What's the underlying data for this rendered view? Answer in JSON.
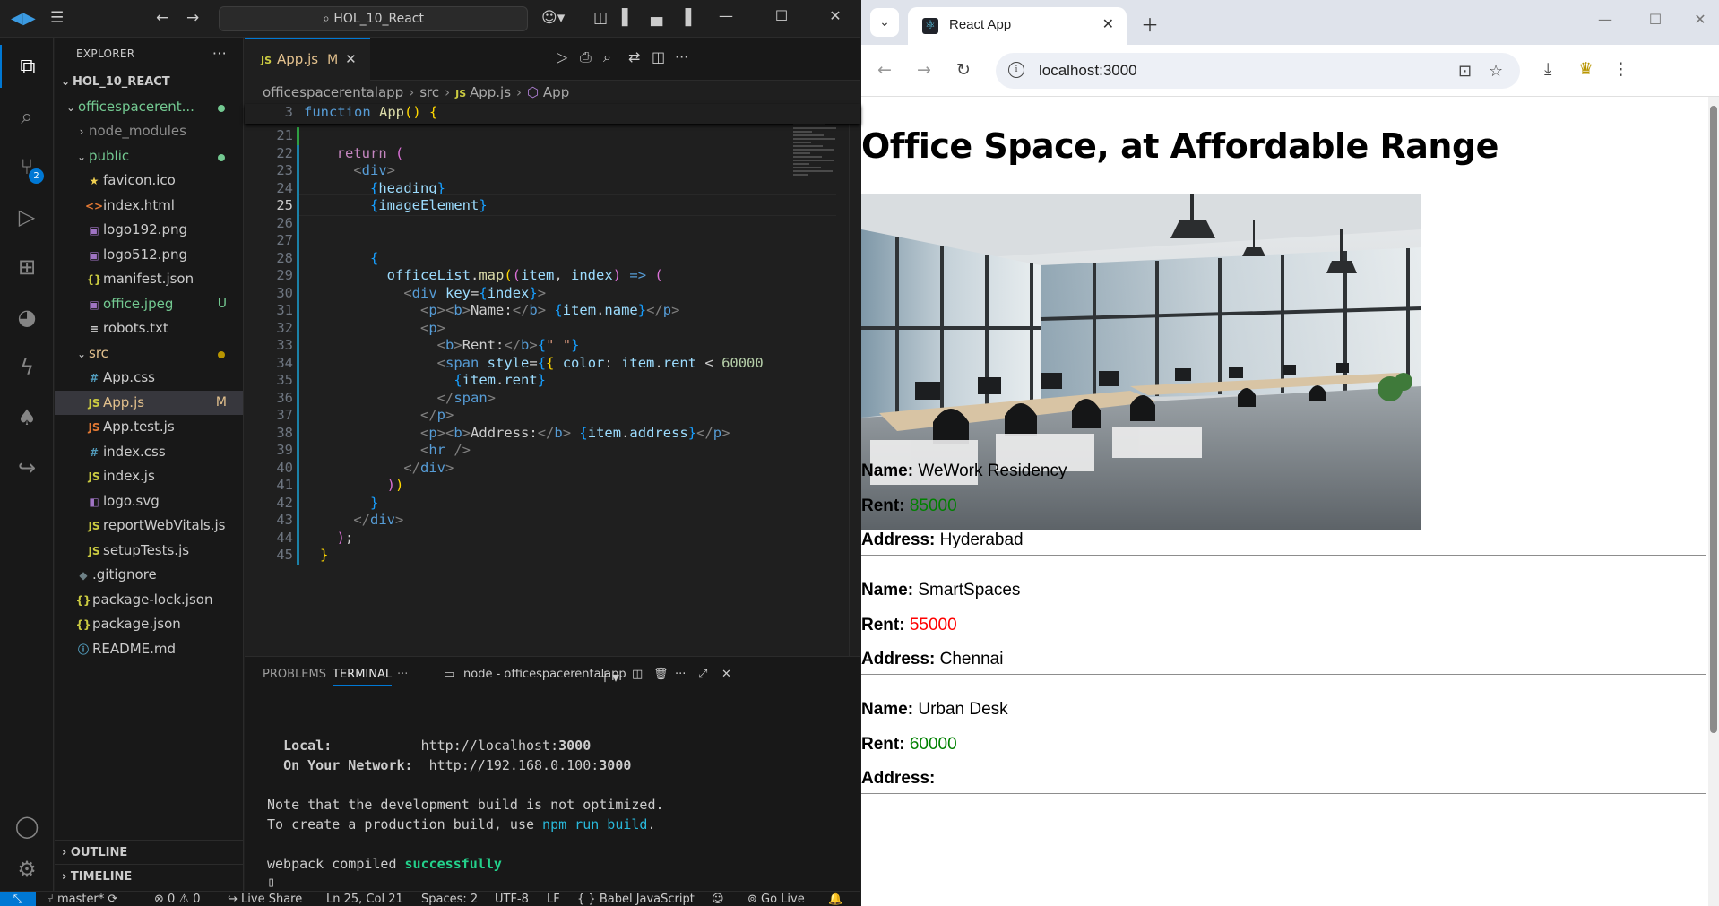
{
  "vscode": {
    "search_text": "HOL_10_React",
    "source_control_badge": "2",
    "explorer": {
      "title": "EXPLORER",
      "project": "HOL_10_REACT",
      "tree": [
        {
          "label": "officespacerent...",
          "kind": "folder-open",
          "indent": 1,
          "color": "#73c991",
          "dot": "#73c991"
        },
        {
          "label": "node_modules",
          "kind": "folder",
          "indent": 2,
          "color": "#8c8c8c"
        },
        {
          "label": "public",
          "kind": "folder-open",
          "indent": 2,
          "color": "#73c991",
          "dot": "#73c991"
        },
        {
          "label": "favicon.ico",
          "kind": "star",
          "indent": 3,
          "color": "#cccccc"
        },
        {
          "label": "index.html",
          "kind": "html",
          "indent": 3,
          "color": "#cccccc"
        },
        {
          "label": "logo192.png",
          "kind": "img",
          "indent": 3,
          "color": "#cccccc"
        },
        {
          "label": "logo512.png",
          "kind": "img",
          "indent": 3,
          "color": "#cccccc"
        },
        {
          "label": "manifest.json",
          "kind": "json",
          "indent": 3,
          "color": "#cccccc"
        },
        {
          "label": "office.jpeg",
          "kind": "img",
          "indent": 3,
          "color": "#73c991",
          "status": "U"
        },
        {
          "label": "robots.txt",
          "kind": "txt",
          "indent": 3,
          "color": "#cccccc"
        },
        {
          "label": "src",
          "kind": "folder-open",
          "indent": 2,
          "color": "#e2c08d",
          "dot": "#b89500"
        },
        {
          "label": "App.css",
          "kind": "css",
          "indent": 3,
          "color": "#cccccc"
        },
        {
          "label": "App.js",
          "kind": "js",
          "indent": 3,
          "color": "#e2c08d",
          "status": "M",
          "selected": true
        },
        {
          "label": "App.test.js",
          "kind": "jstest",
          "indent": 3,
          "color": "#cccccc"
        },
        {
          "label": "index.css",
          "kind": "css",
          "indent": 3,
          "color": "#cccccc"
        },
        {
          "label": "index.js",
          "kind": "js",
          "indent": 3,
          "color": "#cccccc"
        },
        {
          "label": "logo.svg",
          "kind": "svg",
          "indent": 3,
          "color": "#cccccc"
        },
        {
          "label": "reportWebVitals.js",
          "kind": "js",
          "indent": 3,
          "color": "#cccccc"
        },
        {
          "label": "setupTests.js",
          "kind": "js",
          "indent": 3,
          "color": "#cccccc"
        },
        {
          "label": ".gitignore",
          "kind": "git",
          "indent": 2,
          "color": "#cccccc"
        },
        {
          "label": "package-lock.json",
          "kind": "json",
          "indent": 2,
          "color": "#cccccc"
        },
        {
          "label": "package.json",
          "kind": "json",
          "indent": 2,
          "color": "#cccccc"
        },
        {
          "label": "README.md",
          "kind": "info",
          "indent": 2,
          "color": "#cccccc"
        }
      ],
      "outline": "OUTLINE",
      "timeline": "TIMELINE"
    },
    "tab": {
      "label": "App.js",
      "modified": "M"
    },
    "breadcrumb": [
      "officespacerentalapp",
      "src",
      "App.js",
      "App"
    ],
    "sticky": {
      "line": "3",
      "code": "function App() {"
    },
    "code_lines": [
      {
        "n": "21",
        "html": ""
      },
      {
        "n": "22",
        "html": "  <span class=\"kw2\">return</span> <span class=\"brc2\">(</span>"
      },
      {
        "n": "23",
        "html": "    <span class=\"br\">&lt;</span><span class=\"tag\">div</span><span class=\"br\">&gt;</span>"
      },
      {
        "n": "24",
        "html": "      <span class=\"brc3\">{</span><span class=\"var\">heading</span><span class=\"brc3\">}</span>"
      },
      {
        "n": "25",
        "html": "      <span class=\"brc3\">{</span><span class=\"var\">imageElement</span><span class=\"brc3\">}</span>"
      },
      {
        "n": "26",
        "html": ""
      },
      {
        "n": "27",
        "html": ""
      },
      {
        "n": "28",
        "html": "      <span class=\"brc3\">{</span>"
      },
      {
        "n": "29",
        "html": "        <span class=\"var\">officeList</span>.<span class=\"fn\">map</span><span class=\"brc1\">(</span><span class=\"brc2\">(</span><span class=\"var\">item</span>, <span class=\"var\">index</span><span class=\"brc2\">)</span> <span class=\"kw\">=&gt;</span> <span class=\"brc2\">(</span>"
      },
      {
        "n": "30",
        "html": "          <span class=\"br\">&lt;</span><span class=\"tag\">div</span> <span class=\"var\">key</span>=<span class=\"brc3\">{</span><span class=\"var\">index</span><span class=\"brc3\">}</span><span class=\"br\">&gt;</span>"
      },
      {
        "n": "31",
        "html": "            <span class=\"br\">&lt;</span><span class=\"tag\">p</span><span class=\"br\">&gt;&lt;</span><span class=\"tag\">b</span><span class=\"br\">&gt;</span>Name:<span class=\"br\">&lt;/</span><span class=\"tag\">b</span><span class=\"br\">&gt;</span> <span class=\"brc3\">{</span><span class=\"var\">item</span>.<span class=\"var\">name</span><span class=\"brc3\">}</span><span class=\"br\">&lt;/</span><span class=\"tag\">p</span><span class=\"br\">&gt;</span>"
      },
      {
        "n": "32",
        "html": "            <span class=\"br\">&lt;</span><span class=\"tag\">p</span><span class=\"br\">&gt;</span>"
      },
      {
        "n": "33",
        "html": "              <span class=\"br\">&lt;</span><span class=\"tag\">b</span><span class=\"br\">&gt;</span>Rent:<span class=\"br\">&lt;/</span><span class=\"tag\">b</span><span class=\"br\">&gt;</span><span class=\"brc3\">{</span><span class=\"str\">\" \"</span><span class=\"brc3\">}</span>"
      },
      {
        "n": "34",
        "html": "              <span class=\"br\">&lt;</span><span class=\"tag\">span</span> <span class=\"var\">style</span>=<span class=\"brc3\">{</span><span class=\"brc1\">{</span> <span class=\"var\">color</span>: <span class=\"var\">item</span>.<span class=\"var\">rent</span> &lt; <span class=\"num\">60000</span>"
      },
      {
        "n": "35",
        "html": "                <span class=\"brc3\">{</span><span class=\"var\">item</span>.<span class=\"var\">rent</span><span class=\"brc3\">}</span>"
      },
      {
        "n": "36",
        "html": "              <span class=\"br\">&lt;/</span><span class=\"tag\">span</span><span class=\"br\">&gt;</span>"
      },
      {
        "n": "37",
        "html": "            <span class=\"br\">&lt;/</span><span class=\"tag\">p</span><span class=\"br\">&gt;</span>"
      },
      {
        "n": "38",
        "html": "            <span class=\"br\">&lt;</span><span class=\"tag\">p</span><span class=\"br\">&gt;&lt;</span><span class=\"tag\">b</span><span class=\"br\">&gt;</span>Address:<span class=\"br\">&lt;/</span><span class=\"tag\">b</span><span class=\"br\">&gt;</span> <span class=\"brc3\">{</span><span class=\"var\">item</span>.<span class=\"var\">address</span><span class=\"brc3\">}</span><span class=\"br\">&lt;/</span><span class=\"tag\">p</span><span class=\"br\">&gt;</span>"
      },
      {
        "n": "39",
        "html": "            <span class=\"br\">&lt;</span><span class=\"tag\">hr</span> <span class=\"br\">/&gt;</span>"
      },
      {
        "n": "40",
        "html": "          <span class=\"br\">&lt;/</span><span class=\"tag\">div</span><span class=\"br\">&gt;</span>"
      },
      {
        "n": "41",
        "html": "        <span class=\"brc2\">)</span><span class=\"brc1\">)</span>"
      },
      {
        "n": "42",
        "html": "      <span class=\"brc3\">}</span>"
      },
      {
        "n": "43",
        "html": "    <span class=\"br\">&lt;/</span><span class=\"tag\">div</span><span class=\"br\">&gt;</span>"
      },
      {
        "n": "44",
        "html": "  <span class=\"brc2\">)</span>;"
      },
      {
        "n": "45",
        "html": "<span class=\"brc1\">}</span>"
      }
    ],
    "current_line": "25",
    "panel": {
      "tabs": [
        "PROBLEMS",
        "TERMINAL"
      ],
      "terminal_name": "node - officespacerentalapp",
      "local_label": "Local:",
      "local_url_prefix": "http://localhost:",
      "local_port": "3000",
      "network_label": "On Your Network:",
      "network_url_prefix": "http://192.168.0.100:",
      "network_port": "3000",
      "note1": "Note that the development build is not optimized.",
      "note2_prefix": "To create a production build, use ",
      "note2_cmd": "npm run build",
      "note2_suffix": ".",
      "compiled_prefix": "webpack compiled ",
      "compiled_status": "successfully"
    },
    "status": {
      "branch": "master*",
      "errors": "0",
      "warnings": "0",
      "live_share": "Live Share",
      "position": "Ln 25, Col 21",
      "spaces": "Spaces: 2",
      "encoding": "UTF-8",
      "eol": "LF",
      "language": "Babel JavaScript",
      "go_live": "Go Live"
    }
  },
  "chrome": {
    "tab_title": "React App",
    "url": "localhost:3000",
    "page": {
      "heading": "Office Space, at Affordable Range",
      "labels": {
        "name": "Name:",
        "rent": "Rent:",
        "address": "Address:"
      },
      "offices": [
        {
          "name": "WeWork Residency",
          "rent": "85000",
          "rent_color": "#008000",
          "address": "Hyderabad"
        },
        {
          "name": "SmartSpaces",
          "rent": "55000",
          "rent_color": "#ff0000",
          "address": "Chennai"
        },
        {
          "name": "Urban Desk",
          "rent": "60000",
          "rent_color": "#008000",
          "address": ""
        }
      ]
    }
  }
}
